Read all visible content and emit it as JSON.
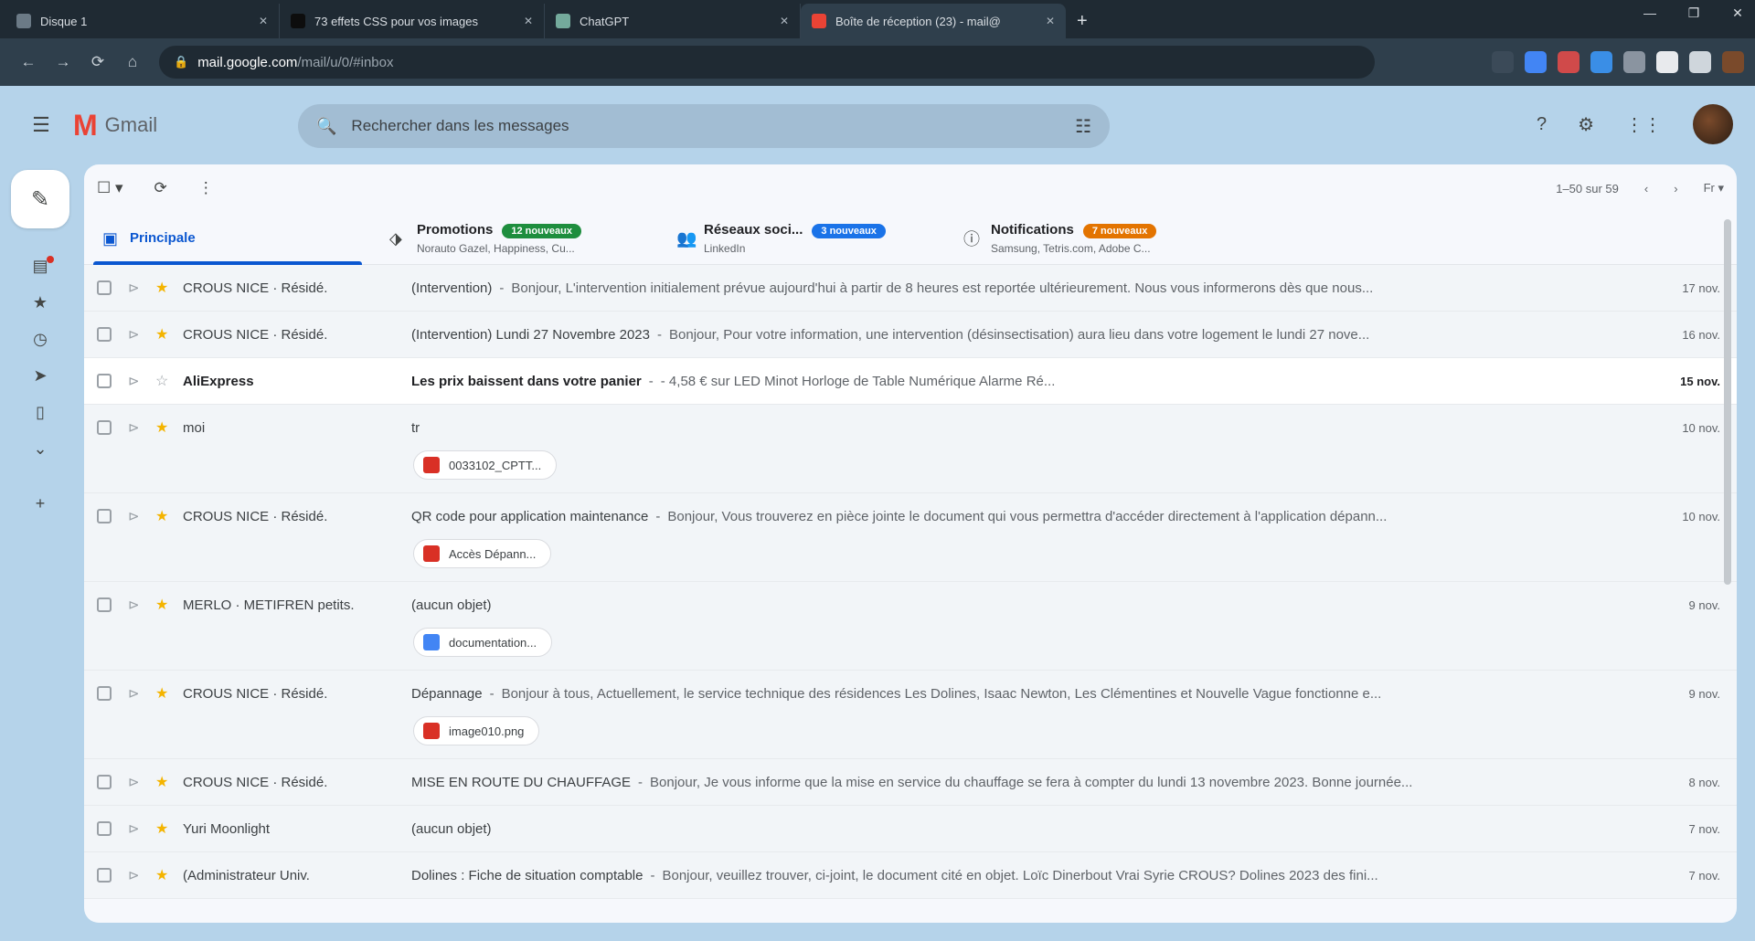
{
  "browser": {
    "tabs": [
      {
        "label": "Disque 1",
        "fav": "#6b7a86",
        "width": 300
      },
      {
        "label": "73 effets CSS pour vos images",
        "fav": "#0d0d0d",
        "width": 290
      },
      {
        "label": "ChatGPT",
        "fav": "#74aa9c",
        "width": 280
      },
      {
        "label": "Boîte de réception (23) - mail@",
        "fav": "#ea4335",
        "width": 290,
        "active": true
      }
    ],
    "new_tab": "+",
    "window": {
      "minimize": "—",
      "restore": "❐",
      "close": "✕"
    },
    "nav": {
      "back": "←",
      "forward": "→",
      "reload": "⟳",
      "home": "⌂"
    },
    "url_host": "mail.google.com",
    "url_path": "/mail/u/0/#inbox",
    "extension_colors": [
      "#3b4a58",
      "#4285f4",
      "#d04a4a",
      "#3a8ee6",
      "#8a94a0",
      "#e8eaed",
      "#cfd6dc",
      "#7a4a2b"
    ]
  },
  "gmail": {
    "app_name": "Gmail",
    "search_placeholder": "Rechercher dans les messages",
    "header_icons": {
      "help": "?",
      "settings": "⚙",
      "apps": "⋮⋮"
    },
    "toolbar": {
      "select": "☐ ▾",
      "refresh": "⟳",
      "more": "⋮",
      "pagination": "1–50 sur 59",
      "prev": "‹",
      "next": "›",
      "lang": "Fr ▾"
    },
    "categories": [
      {
        "title": "Principale",
        "subtitle": "",
        "icon": "▣",
        "active": true
      },
      {
        "title": "Promotions",
        "subtitle": "Norauto Gazel, Happiness, Cu...",
        "icon": "⬗",
        "badge": "12 nouveaux",
        "badge_color": "#1e8e3e"
      },
      {
        "title": "Réseaux soci...",
        "subtitle": "LinkedIn",
        "icon": "👥",
        "badge": "3 nouveaux",
        "badge_color": "#1a73e8"
      },
      {
        "title": "Notifications",
        "subtitle": "Samsung, Tetris.com, Adobe C...",
        "icon": "ⓘ",
        "badge": "7 nouveaux",
        "badge_color": "#e37400"
      }
    ],
    "emails": [
      {
        "sender": "CROUS NICE · Résidé.",
        "subject": "(Intervention)",
        "snippet": "Bonjour, L'intervention initialement prévue aujourd'hui à partir de 8 heures est reportée ultérieurement. Nous vous informerons dès que nous...",
        "date": "17 nov.",
        "unread": false,
        "starred": true
      },
      {
        "sender": "CROUS NICE · Résidé.",
        "subject": "(Intervention) Lundi 27 Novembre 2023",
        "snippet": "Bonjour, Pour votre information, une intervention (désinsectisation) aura lieu dans votre logement le lundi 27 nove...",
        "date": "16 nov.",
        "unread": false,
        "starred": true
      },
      {
        "sender": "AliExpress",
        "subject": "Les prix baissent dans votre panier",
        "snippet": "- 4,58 € sur LED Minot Horloge de Table Numérique Alarme Ré...",
        "date": "15 nov.",
        "unread": true,
        "starred": false
      },
      {
        "sender": "moi",
        "subject": "tr",
        "snippet": "",
        "date": "10 nov.",
        "unread": false,
        "starred": true,
        "attachment": {
          "name": "0033102_CPTT...",
          "color": "#d93025"
        }
      },
      {
        "sender": "CROUS NICE · Résidé.",
        "subject": "QR code pour application maintenance",
        "snippet": "Bonjour, Vous trouverez en pièce jointe le document qui vous permettra d'accéder directement à l'application dépann...",
        "date": "10 nov.",
        "unread": false,
        "starred": true,
        "attachment": {
          "name": "Accès Dépann...",
          "color": "#d93025"
        }
      },
      {
        "sender": "MERLO · METIFREN petits.",
        "subject": "(aucun objet)",
        "snippet": "",
        "date": "9 nov.",
        "unread": false,
        "starred": true,
        "attachment": {
          "name": "documentation...",
          "color": "#4285f4"
        }
      },
      {
        "sender": "CROUS NICE · Résidé.",
        "subject": "Dépannage",
        "snippet": "Bonjour à tous, Actuellement, le service technique des résidences Les Dolines, Isaac Newton, Les Clémentines et Nouvelle Vague fonctionne e...",
        "date": "9 nov.",
        "unread": false,
        "starred": true,
        "attachment": {
          "name": "image010.png",
          "color": "#d93025"
        }
      },
      {
        "sender": "CROUS NICE · Résidé.",
        "subject": "MISE EN ROUTE DU CHAUFFAGE",
        "snippet": "Bonjour, Je vous informe que la mise en service du chauffage se fera à compter du lundi 13 novembre 2023. Bonne journée...",
        "date": "8 nov.",
        "unread": false,
        "starred": true
      },
      {
        "sender": "Yuri Moonlight",
        "subject": "(aucun objet)",
        "snippet": "",
        "date": "7 nov.",
        "unread": false,
        "starred": true
      },
      {
        "sender": "(Administrateur Univ.",
        "subject": "Dolines : Fiche de situation comptable",
        "snippet": "Bonjour, veuillez trouver, ci-joint, le document cité en objet. Loïc Dinerbout Vrai Syrie CROUS? Dolines 2023 des fini...",
        "date": "7 nov.",
        "unread": false,
        "starred": true
      }
    ]
  },
  "colors": {
    "star": "#f4b400",
    "accent": "#0b57d0"
  }
}
